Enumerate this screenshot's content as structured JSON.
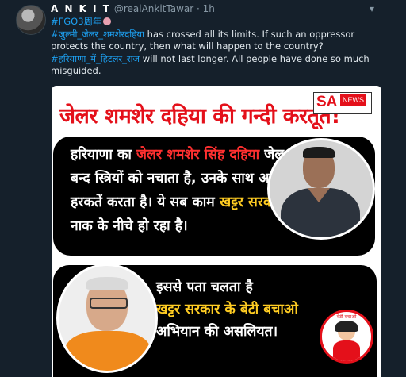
{
  "tweet": {
    "display_name": "A N K I T",
    "handle": "@realAnkitTawar",
    "time": "· 1h",
    "hashtag1": "#FGO3周年",
    "hashtag2": "#जुल्मी_जेलर_शमशेरदहिया",
    "text1": " has crossed all its limits. If such an oppressor protects the country, then what will happen to the country?",
    "hashtag3": "#हरियाणा_में_हिटलर_राज",
    "text2": " will not last longer. All people have done so much misguided."
  },
  "image": {
    "headline": "जेलर शमशेर दहिया की गन्दी करतूत!",
    "logo_sa": "SA",
    "logo_news": "NEWS",
    "panel1": {
      "line1_a": "हरियाणा का ",
      "line1_b": "जेलर शमशेर सिंह दहिया",
      "line2": "जेल में बन्द स्त्रियों को नचाता है, उनके साथ अश्लील हरकतें करता है। ये सब काम ",
      "line3_hl": "खट्टर सरकार",
      "line3_b": " की नाक के नीचे हो रहा है।"
    },
    "panel2": {
      "line1": "इससे पता चलता है",
      "line2_hl": "खट्टर सरकार के बेटी बचाओ",
      "line3": "अभियान की असलियत।"
    },
    "badge_text": "बेटी बचाओ"
  },
  "icons": {
    "avatar": "avatar-photo",
    "caret": "chevron-down-icon",
    "emoji": "emoji-icon"
  }
}
